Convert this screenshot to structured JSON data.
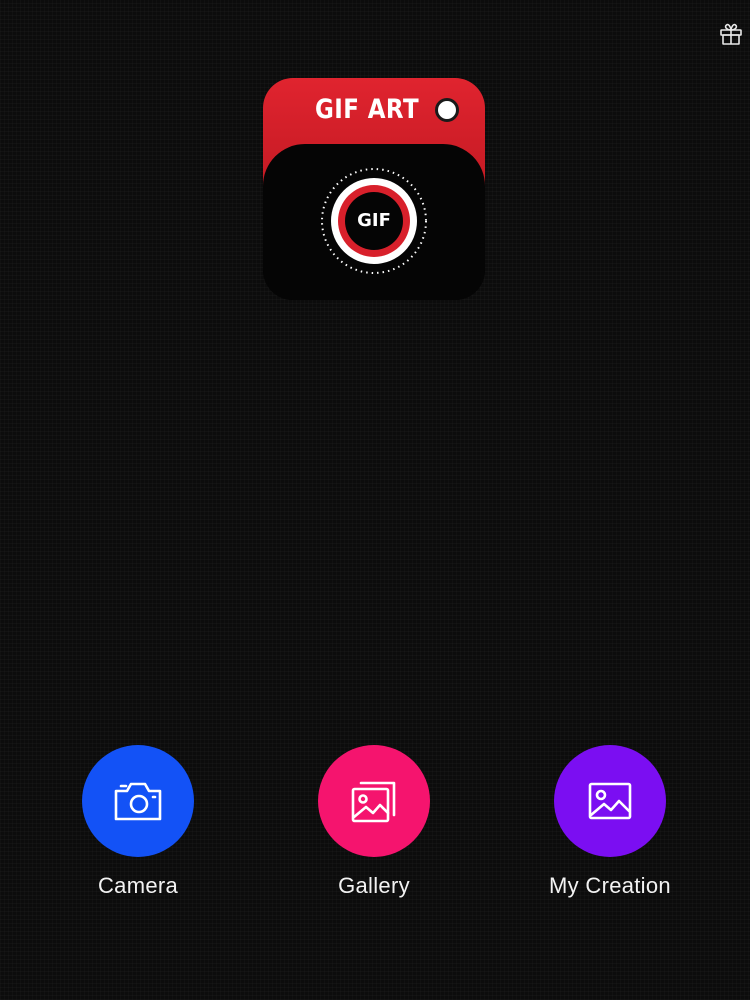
{
  "header": {
    "gift_icon": "gift-icon"
  },
  "logo": {
    "title": "GIF ART",
    "badge": "GIF",
    "colors": {
      "red": "#d8202b",
      "black": "#050505",
      "white": "#ffffff"
    }
  },
  "actions": [
    {
      "label": "Camera",
      "icon": "camera-icon",
      "color": "#1352f6"
    },
    {
      "label": "Gallery",
      "icon": "gallery-icon",
      "color": "#f5146e"
    },
    {
      "label": "My Creation",
      "icon": "image-icon",
      "color": "#7b0ef2"
    }
  ]
}
